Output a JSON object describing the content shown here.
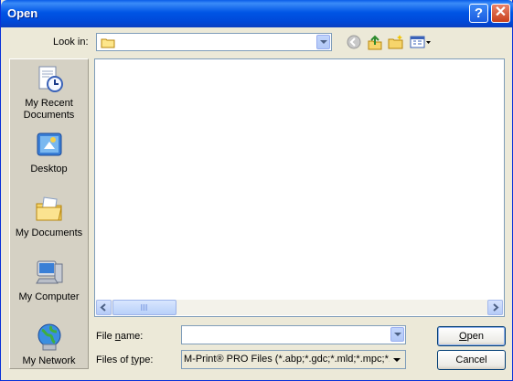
{
  "window": {
    "title": "Open"
  },
  "titlebar": {
    "help": "?",
    "close": "✕"
  },
  "lookin": {
    "label": "Look in:",
    "value": ""
  },
  "toolbar": {
    "back": "back-icon",
    "up": "up-folder-icon",
    "newfolder": "new-folder-icon",
    "views": "views-menu-icon"
  },
  "places": [
    {
      "label": "My Recent\nDocuments",
      "icon": "recent-documents-icon"
    },
    {
      "label": "Desktop",
      "icon": "desktop-icon"
    },
    {
      "label": "My Documents",
      "icon": "my-documents-icon"
    },
    {
      "label": "My Computer",
      "icon": "my-computer-icon"
    },
    {
      "label": "My Network",
      "icon": "my-network-icon"
    }
  ],
  "filename": {
    "label": "File name:",
    "value": ""
  },
  "filetype": {
    "label": "Files of type:",
    "value": "M-Print® PRO Files (*.abp;*.gdc;*.mld;*.mpc;*.m"
  },
  "buttons": {
    "open": "Open",
    "cancel": "Cancel"
  },
  "colors": {
    "titlebar": "#0055e5",
    "dialog": "#ece9d8",
    "close": "#c9401b"
  }
}
